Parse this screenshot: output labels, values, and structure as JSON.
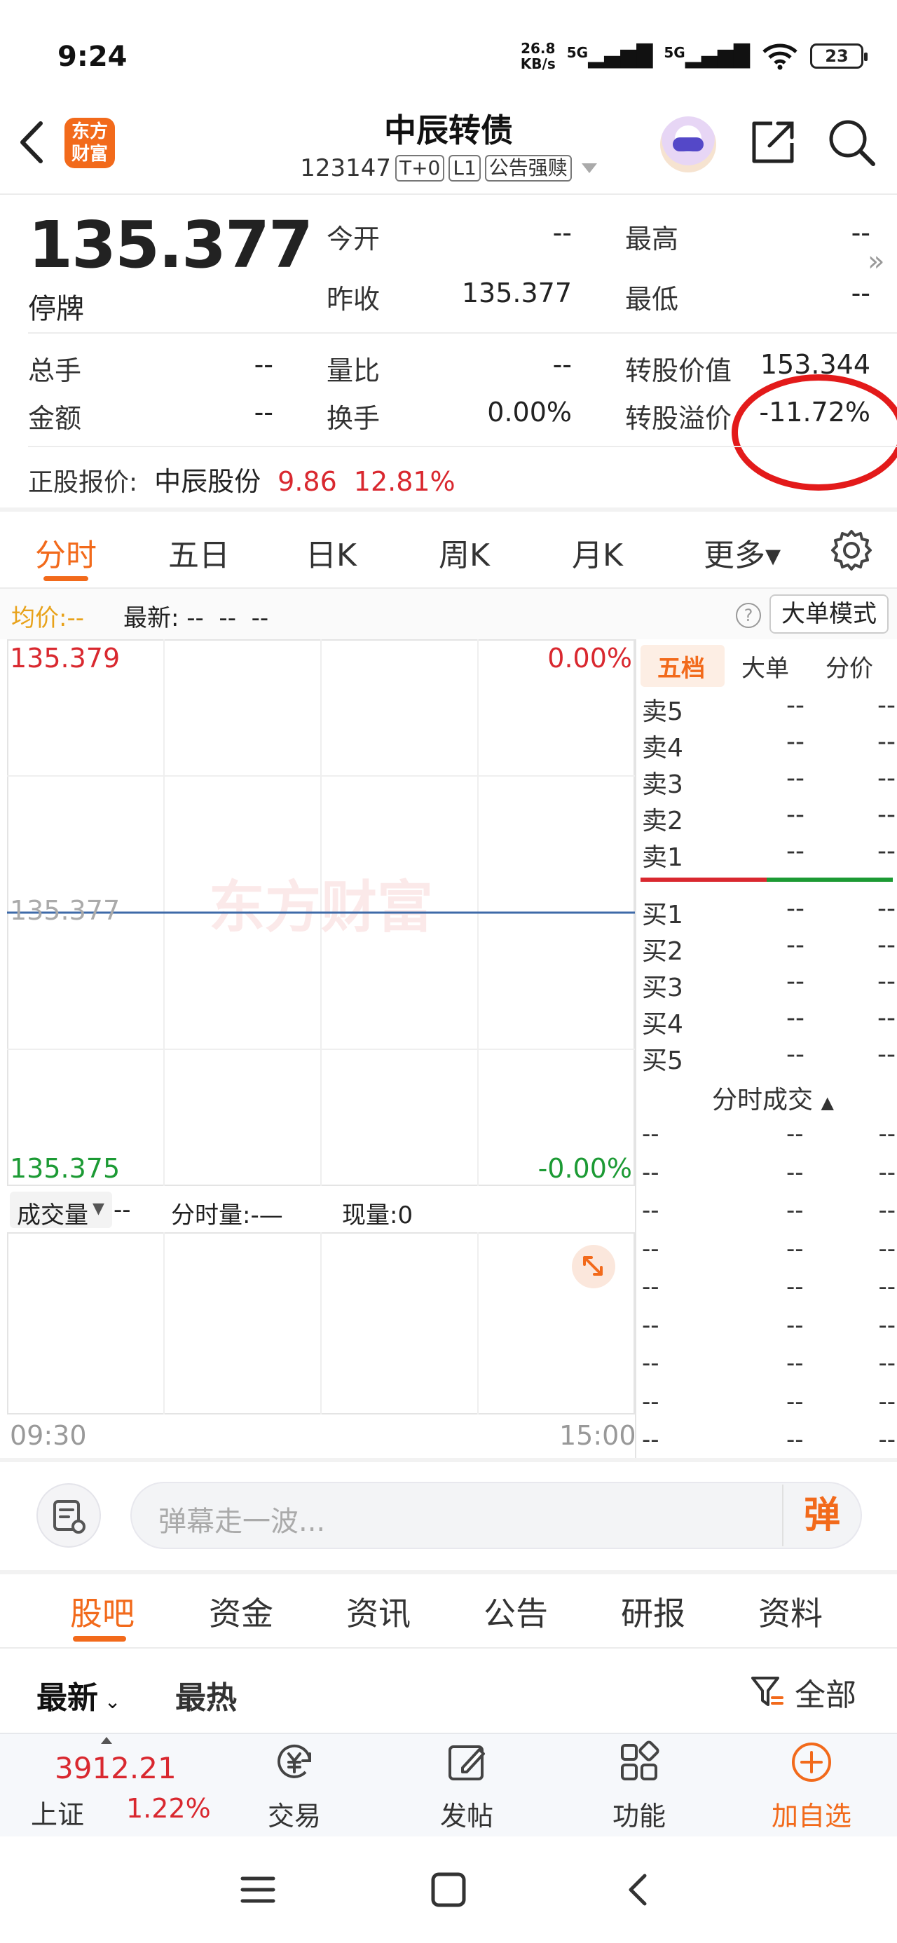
{
  "status": {
    "time": "9:24",
    "net_speed": "26.8",
    "net_unit": "KB/s",
    "signal1": "5G",
    "signal2": "5G",
    "battery": "23"
  },
  "header": {
    "back_icon": "back-arrow-icon",
    "logo_line1": "东方",
    "logo_line2": "财富",
    "title": "中辰转债",
    "code": "123147",
    "tags": [
      "T+0",
      "L1",
      "公告强赎"
    ]
  },
  "quote": {
    "price": "135.377",
    "status": "停牌",
    "grid": [
      {
        "label": "今开",
        "value": "--"
      },
      {
        "label": "最高",
        "value": "--"
      },
      {
        "label": "昨收",
        "value": "135.377"
      },
      {
        "label": "最低",
        "value": "--"
      },
      {
        "label": "总手",
        "value": "--"
      },
      {
        "label": "量比",
        "value": "--"
      },
      {
        "label": "转股价值",
        "value": "153.344"
      },
      {
        "label": "金额",
        "value": "--"
      },
      {
        "label": "换手",
        "value": "0.00%"
      },
      {
        "label": "转股溢价",
        "value": "-11.72%"
      }
    ],
    "stock_label": "正股报价:",
    "stock_name": "中辰股份",
    "stock_price": "9.86",
    "stock_change": "12.81%"
  },
  "chart_tabs": [
    "分时",
    "五日",
    "日K",
    "周K",
    "月K",
    "更多▾"
  ],
  "infobar": {
    "avg_label": "均价:",
    "avg_value": "--",
    "latest_label": "最新:",
    "latest_values": "--  --  --",
    "big_order_mode": "大单模式"
  },
  "chart": {
    "top_price": "135.379",
    "top_pct": "0.00%",
    "mid_price": "135.377",
    "bottom_price": "135.375",
    "bottom_pct": "-0.00%",
    "watermark": "东方财富",
    "volume_label": "成交量",
    "volume_value": "--",
    "minute_volume": "分时量:-—",
    "current_volume": "现量:0",
    "time_start": "09:30",
    "time_end": "15:00"
  },
  "chart_data": {
    "type": "line",
    "x": [
      "09:30",
      "15:00"
    ],
    "series": [
      {
        "values": [
          135.377,
          135.377
        ]
      }
    ],
    "ylim": [
      135.375,
      135.379
    ]
  },
  "orderbook": {
    "tabs": [
      "五档",
      "大单",
      "分价"
    ],
    "asks": [
      {
        "label": "卖5",
        "price": "--",
        "vol": "--"
      },
      {
        "label": "卖4",
        "price": "--",
        "vol": "--"
      },
      {
        "label": "卖3",
        "price": "--",
        "vol": "--"
      },
      {
        "label": "卖2",
        "price": "--",
        "vol": "--"
      },
      {
        "label": "卖1",
        "price": "--",
        "vol": "--"
      }
    ],
    "bids": [
      {
        "label": "买1",
        "price": "--",
        "vol": "--"
      },
      {
        "label": "买2",
        "price": "--",
        "vol": "--"
      },
      {
        "label": "买3",
        "price": "--",
        "vol": "--"
      },
      {
        "label": "买4",
        "price": "--",
        "vol": "--"
      },
      {
        "label": "买5",
        "price": "--",
        "vol": "--"
      }
    ],
    "ticks_title": "分时成交",
    "ticks": [
      [
        "--",
        "--",
        "--"
      ],
      [
        "--",
        "--",
        "--"
      ],
      [
        "--",
        "--",
        "--"
      ],
      [
        "--",
        "--",
        "--"
      ],
      [
        "--",
        "--",
        "--"
      ],
      [
        "--",
        "--",
        "--"
      ],
      [
        "--",
        "--",
        "--"
      ],
      [
        "--",
        "--",
        "--"
      ],
      [
        "--",
        "--",
        "--"
      ]
    ]
  },
  "danmaku": {
    "placeholder": "弹幕走一波...",
    "send_label": "弹"
  },
  "content_tabs": [
    "股吧",
    "资金",
    "资讯",
    "公告",
    "研报",
    "资料"
  ],
  "sort": {
    "newest": "最新",
    "hottest": "最热",
    "filter": "全部"
  },
  "toolbar": {
    "index_value": "3912.21",
    "index_name": "上证",
    "index_change": "1.22%",
    "items": [
      {
        "label": "交易",
        "icon": "yuan-exchange-icon"
      },
      {
        "label": "发帖",
        "icon": "edit-post-icon"
      },
      {
        "label": "功能",
        "icon": "grid-apps-icon"
      },
      {
        "label": "加自选",
        "icon": "add-circle-icon"
      }
    ]
  },
  "colors": {
    "accent": "#f26a1b",
    "up": "#d9282f",
    "down": "#1c9a34",
    "annotation_circle": "#e31a1a"
  }
}
